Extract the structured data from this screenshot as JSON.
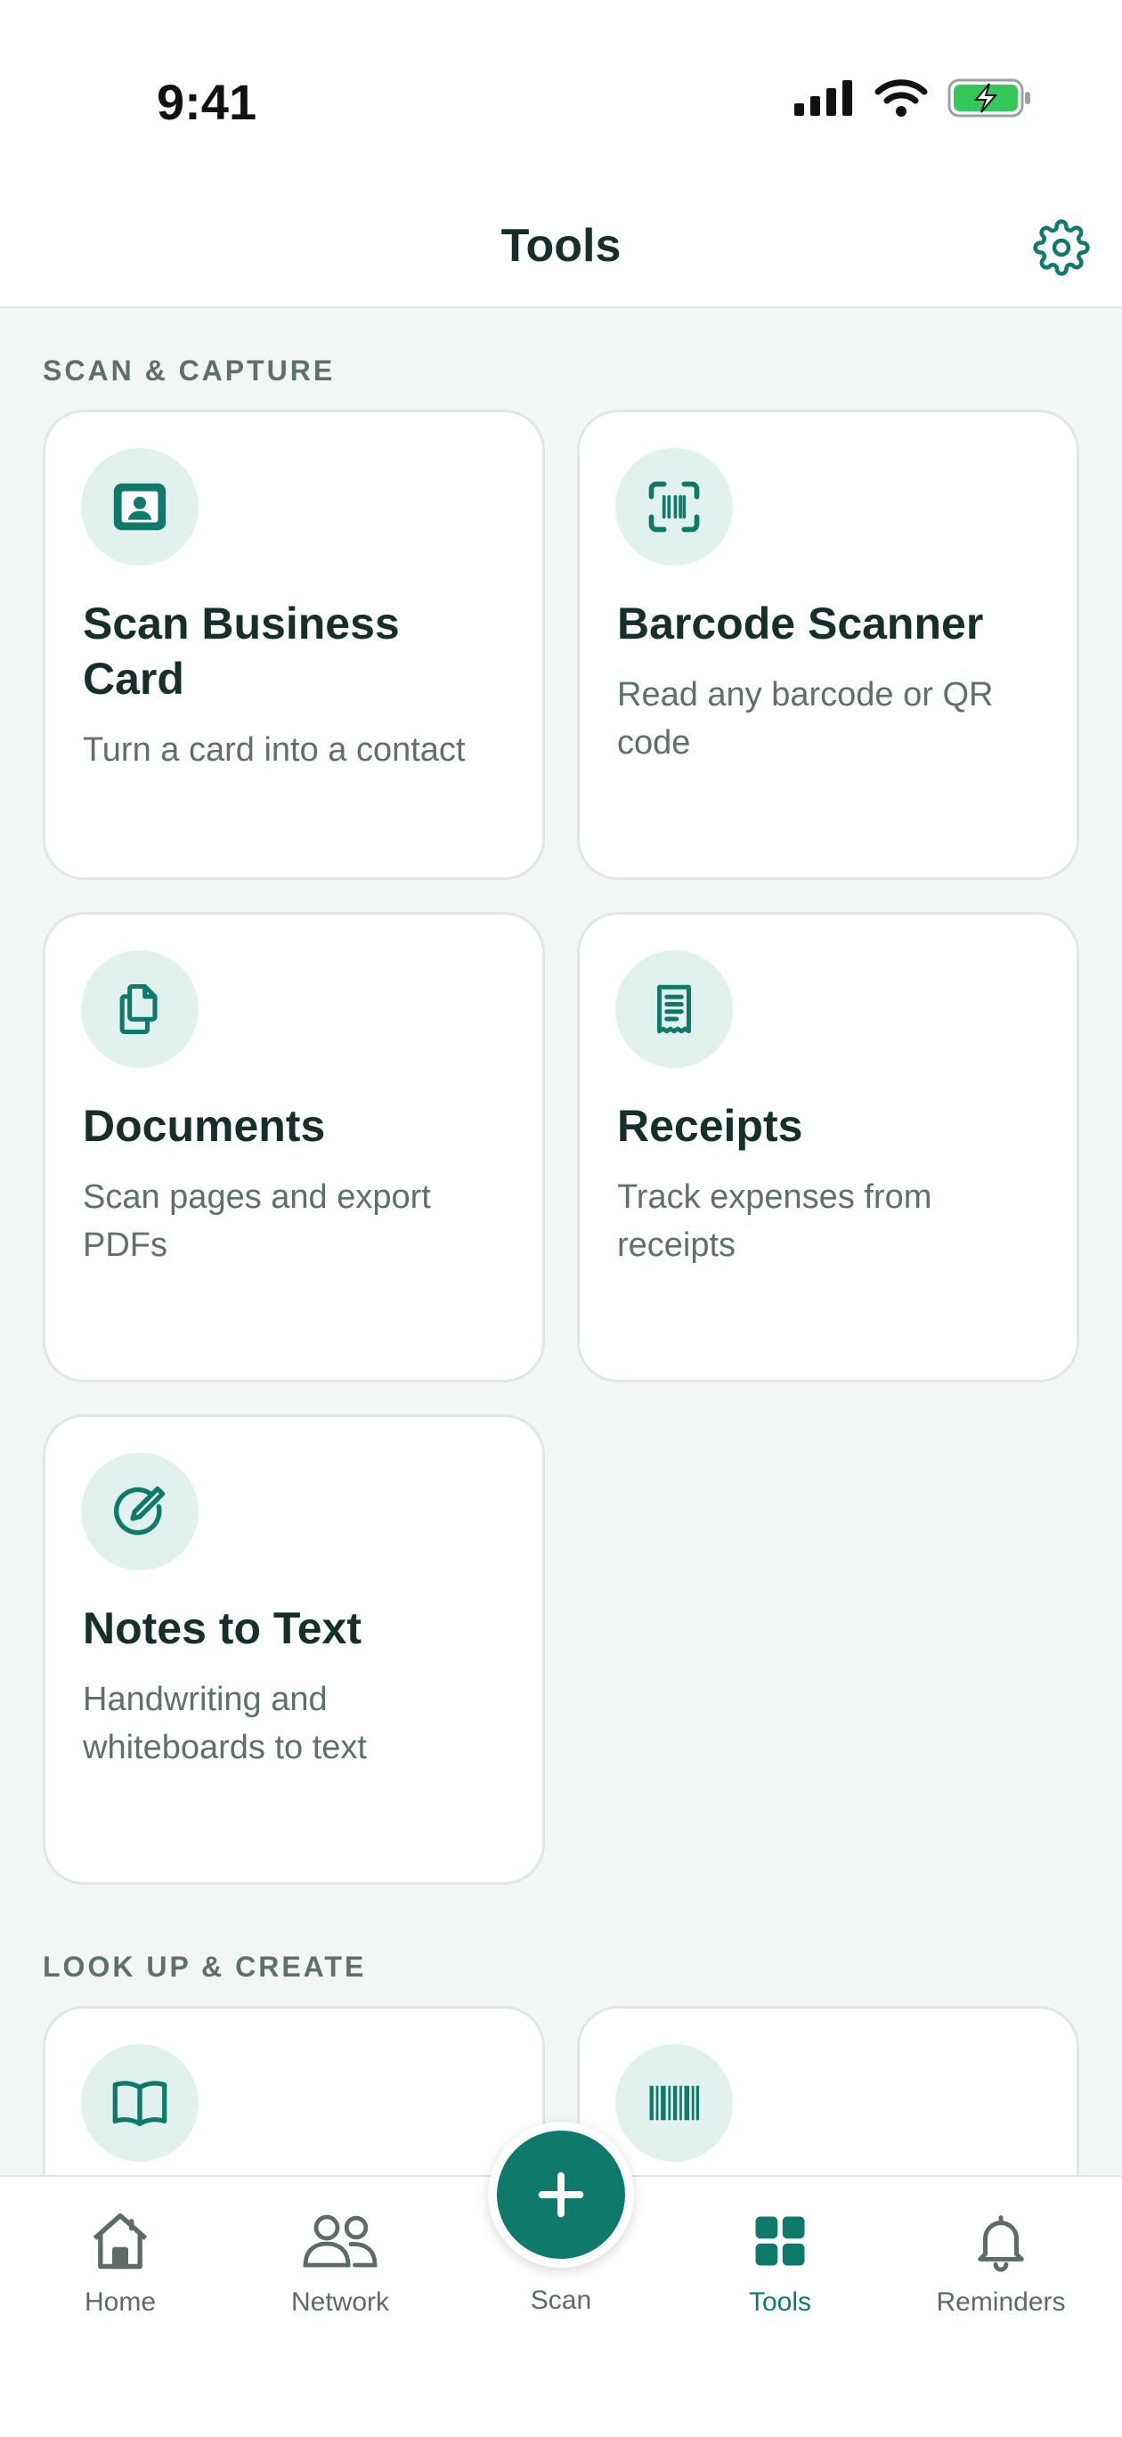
{
  "status_bar": {
    "time": "9:41"
  },
  "header": {
    "title": "Tools"
  },
  "sections": [
    {
      "label": "SCAN & CAPTURE"
    },
    {
      "label": "LOOK UP & CREATE"
    }
  ],
  "cards": [
    {
      "title": "Scan Business Card",
      "desc": "Turn a card into a contact",
      "icon": "contact-card-icon"
    },
    {
      "title": "Barcode Scanner",
      "desc": "Read any barcode or QR code",
      "icon": "barcode-scan-icon"
    },
    {
      "title": "Documents",
      "desc": "Scan pages and export PDFs",
      "icon": "documents-icon"
    },
    {
      "title": "Receipts",
      "desc": "Track expenses from receipts",
      "icon": "receipt-icon"
    },
    {
      "title": "Notes to Text",
      "desc": "Handwriting and whiteboards to text",
      "icon": "pen-circle-icon"
    }
  ],
  "lookup_cards": [
    {
      "icon": "book-icon"
    },
    {
      "icon": "barcode-icon"
    }
  ],
  "tabs": [
    {
      "label": "Home",
      "icon": "home-icon"
    },
    {
      "label": "Network",
      "icon": "people-icon"
    },
    {
      "label": "Scan",
      "icon": "plus-icon"
    },
    {
      "label": "Tools",
      "icon": "grid-icon"
    },
    {
      "label": "Reminders",
      "icon": "bell-icon"
    }
  ],
  "colors": {
    "accent": "#0f7a6b",
    "icon_bg": "#e1f1ee",
    "battery": "#34c759",
    "background": "#f2f6f5"
  }
}
